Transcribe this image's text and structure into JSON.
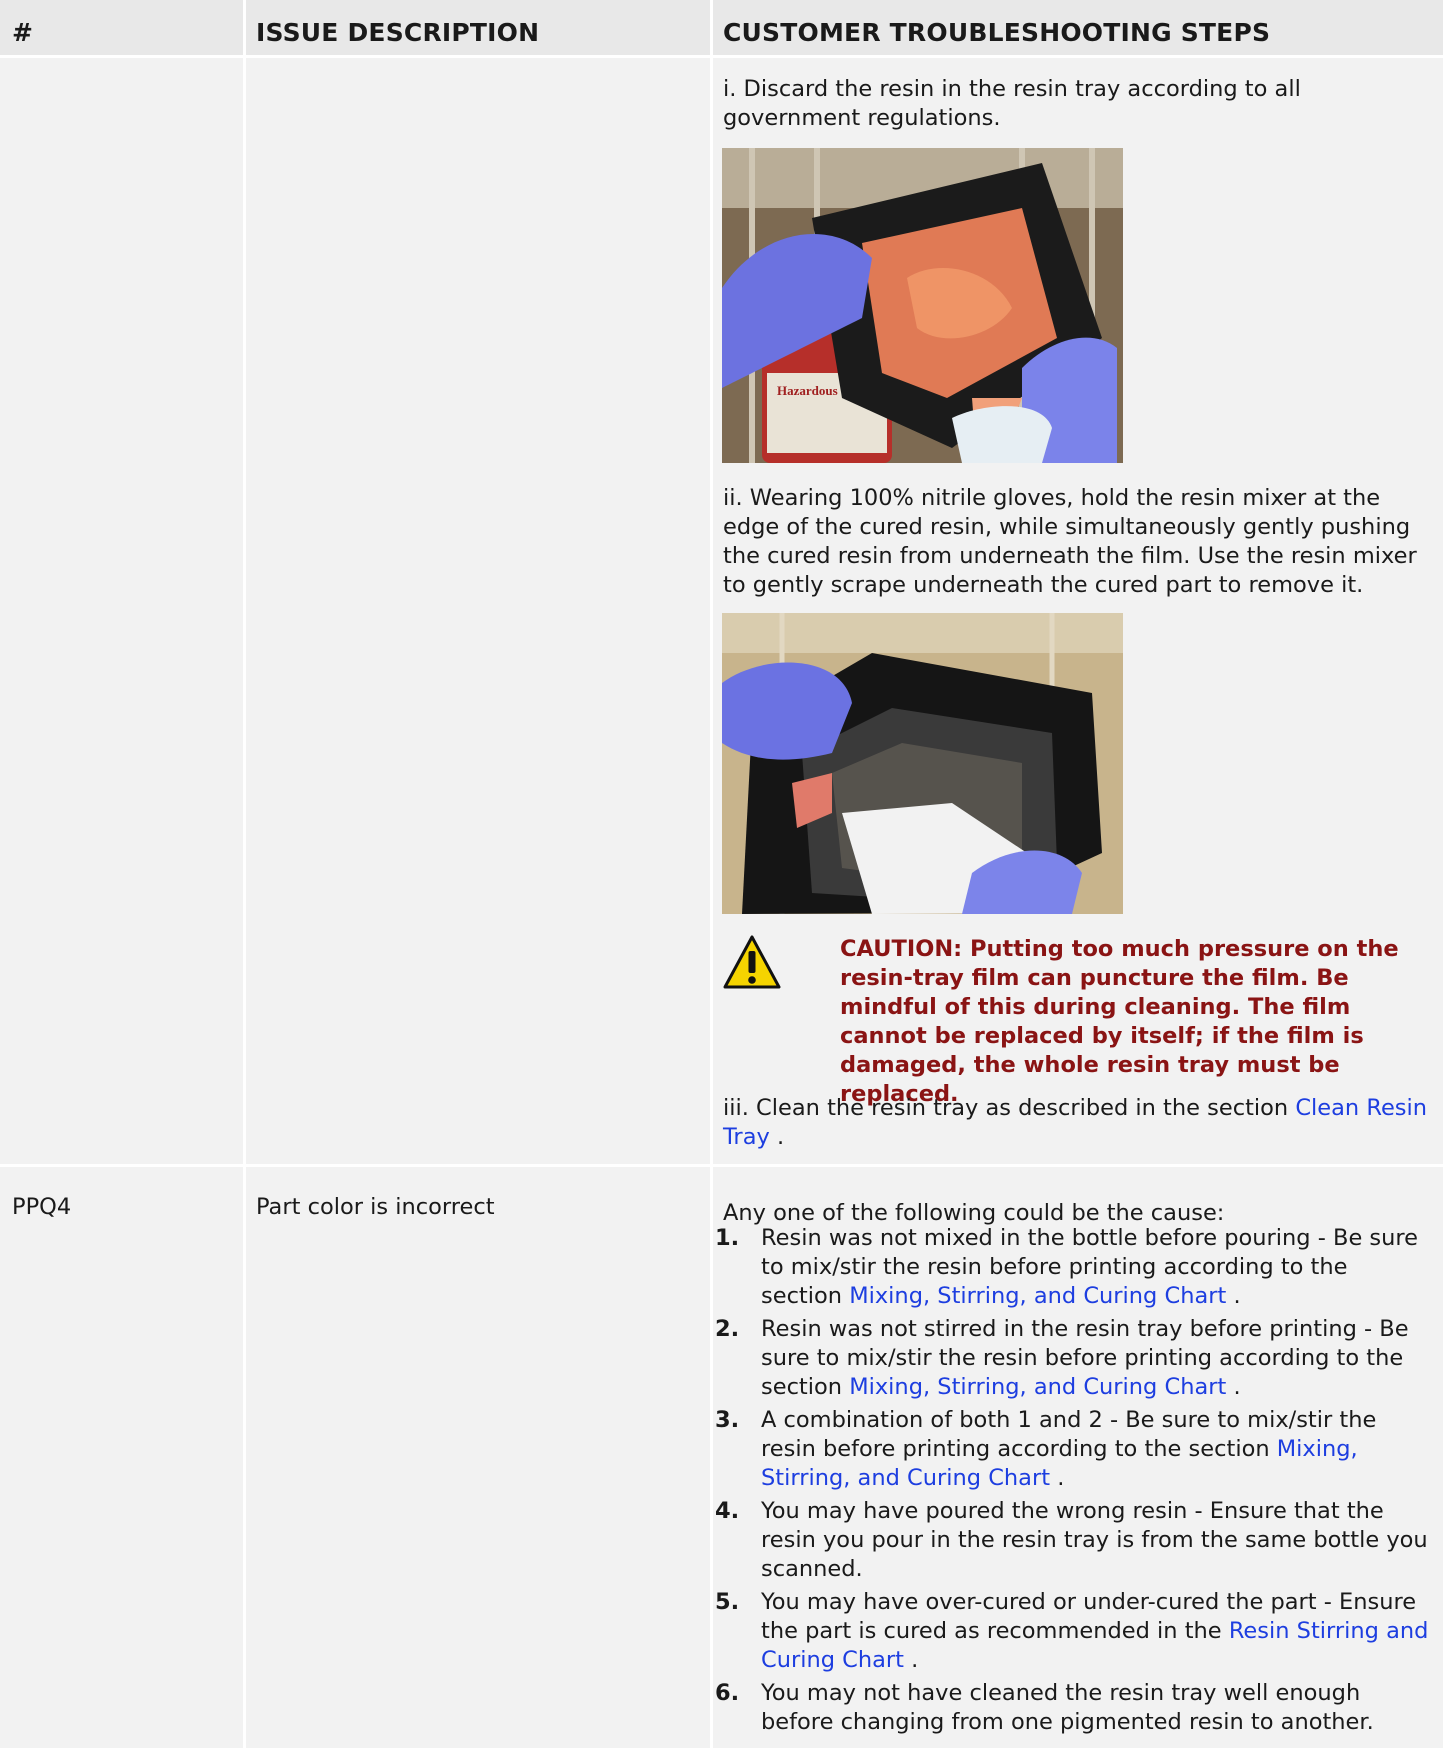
{
  "header": {
    "col_num": "#",
    "col_issue": "ISSUE DESCRIPTION",
    "col_steps": "CUSTOMER TROUBLESHOOTING STEPS"
  },
  "row1": {
    "step_i": "i. Discard the resin in the resin tray according to all government regulations.",
    "step_ii": "ii. Wearing 100% nitrile gloves, hold the resin mixer at the edge of the cured resin, while simultaneously gently pushing the cured resin from underneath the film. Use the resin mixer to gently scrape underneath the cured part to remove it.",
    "caution": "CAUTION: Putting too much pressure on the resin-tray film can puncture the film. Be mindful of this during cleaning. The film cannot be replaced by itself; if the film is damaged, the whole resin tray must be replaced.",
    "step_iii_prefix": "iii. Clean the resin tray as described in the section",
    "step_iii_link": "Clean Resin Tray",
    "step_iii_suffix": ".",
    "photo1_label": "Hazardous Waste"
  },
  "row2": {
    "id": "PPQ4",
    "issue": "Part color is incorrect",
    "intro": "Any one of the following could be the cause:",
    "items": [
      {
        "num": "1.",
        "text": "Resin was not mixed in the bottle before pouring - Be sure to mix/stir the resin before printing according to the section",
        "link": "Mixing, Stirring, and Curing Chart",
        "suffix": "."
      },
      {
        "num": "2.",
        "text": "Resin was not stirred in the resin tray before printing - Be sure to mix/stir the resin before printing according to the section",
        "link": "Mixing, Stirring, and Curing Chart",
        "suffix": "."
      },
      {
        "num": "3.",
        "text": "A combination of both 1 and 2 - Be sure to mix/stir the resin before printing according to the section",
        "link": "Mixing, Stirring, and Curing Chart",
        "suffix": "."
      },
      {
        "num": "4.",
        "text": "You may have poured the wrong resin - Ensure that the resin you pour in the resin tray is from the same bottle you scanned.",
        "link": "",
        "suffix": ""
      },
      {
        "num": "5.",
        "text": "You may have over-cured or under-cured the part - Ensure the part is cured as recommended in the",
        "link": "Resin Stirring and Curing Chart",
        "suffix": "."
      },
      {
        "num": "6.",
        "text": "You may not have cleaned the resin tray well enough before changing from one pigmented resin to another.",
        "link": "",
        "suffix": ""
      }
    ]
  },
  "colors": {
    "header_bg": "#e8e8e8",
    "cell_bg": "#f2f2f2",
    "link": "#1d3ee0",
    "caution": "#8a1414",
    "warning_yellow": "#f5d400"
  }
}
